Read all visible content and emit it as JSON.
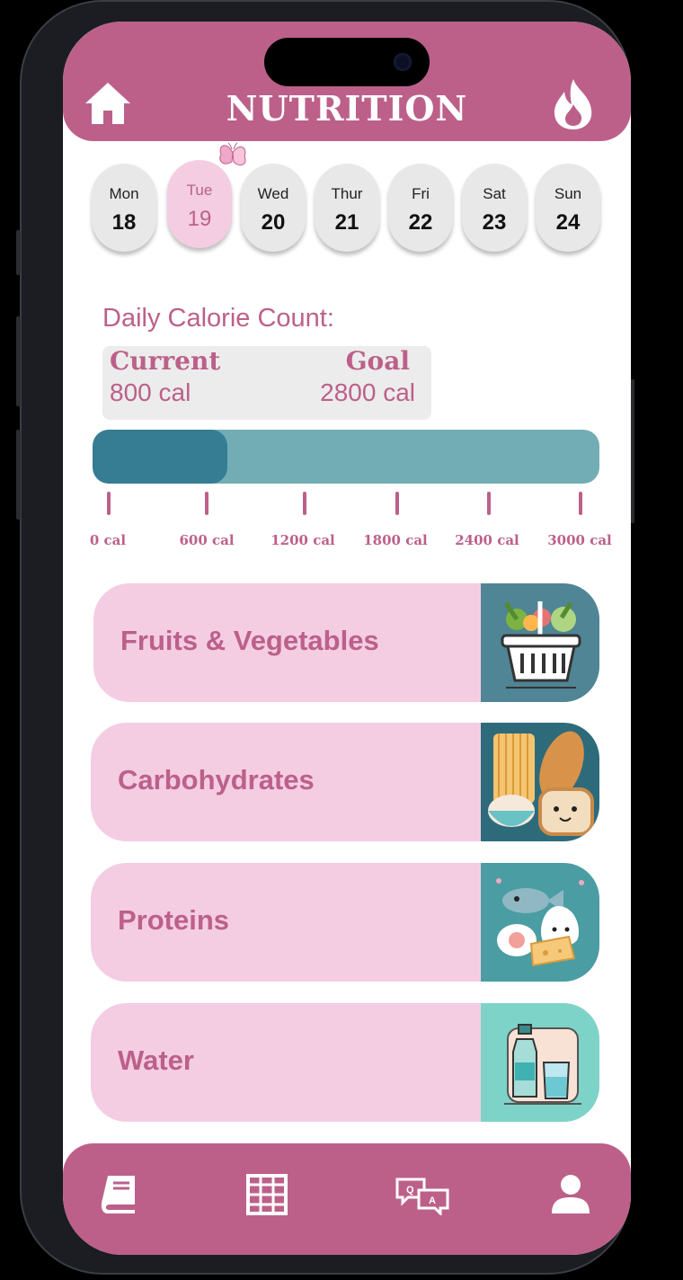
{
  "header": {
    "title": "NUTRITION",
    "left_icon": "home-icon",
    "right_icon": "flame-icon",
    "color": "#bc608a"
  },
  "week": {
    "selected": "Tue",
    "days": [
      {
        "name": "Mon",
        "num": "18"
      },
      {
        "name": "Tue",
        "num": "19"
      },
      {
        "name": "Wed",
        "num": "20"
      },
      {
        "name": "Thur",
        "num": "21"
      },
      {
        "name": "Fri",
        "num": "22"
      },
      {
        "name": "Sat",
        "num": "23"
      },
      {
        "name": "Sun",
        "num": "24"
      }
    ]
  },
  "calories": {
    "heading": "Daily Calorie Count:",
    "current_label": "Current",
    "current_value": "800 cal",
    "goal_label": "Goal",
    "goal_value": "2800 cal",
    "progress_value": 800,
    "scale_max": 3000,
    "ticks": [
      "0 cal",
      "600 cal",
      "1200 cal",
      "1800 cal",
      "2400 cal",
      "3000 cal"
    ]
  },
  "categories": [
    {
      "label": "Fruits & Vegetables",
      "icon": "basket-icon",
      "bg": "#4f8594"
    },
    {
      "label": "Carbohydrates",
      "icon": "bread-pasta-icon",
      "bg": "#2e6b7a"
    },
    {
      "label": "Proteins",
      "icon": "fish-egg-cheese-icon",
      "bg": "#4a9da3"
    },
    {
      "label": "Water",
      "icon": "water-bottle-icon",
      "bg": "#7dd3c7"
    }
  ],
  "bottom_nav": [
    "book-icon",
    "grid-icon",
    "qa-chat-icon",
    "profile-icon"
  ]
}
